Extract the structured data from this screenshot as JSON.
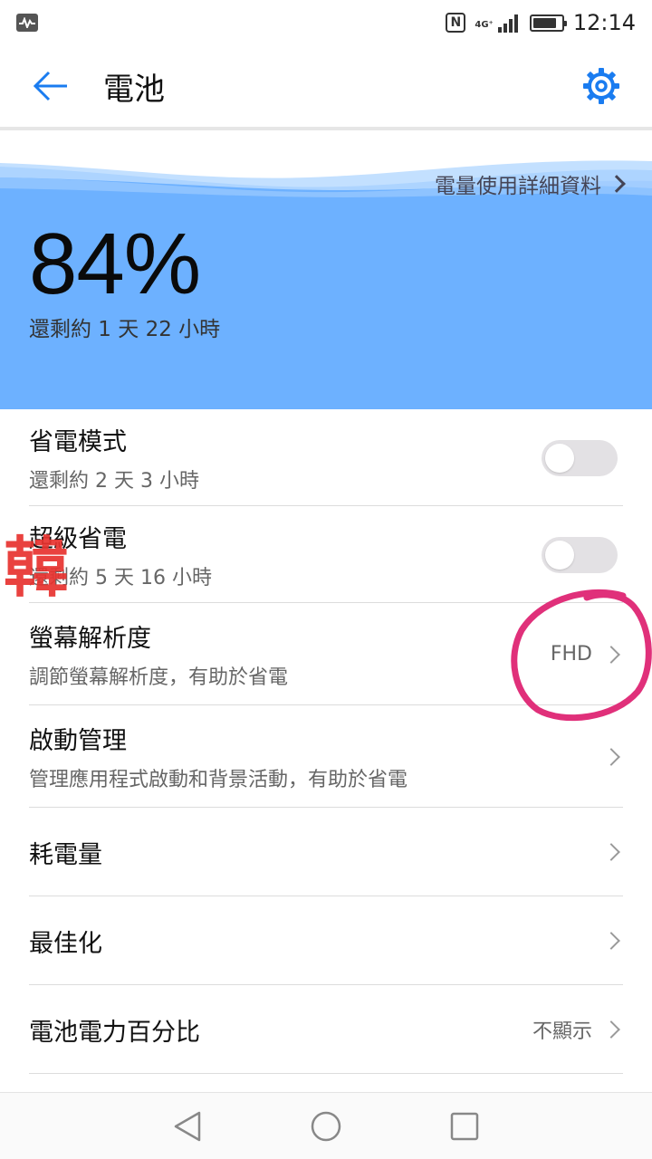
{
  "status_bar": {
    "network": "4G⁺",
    "time": "12:14",
    "battery_level": 0.84,
    "icons": [
      "pulse-icon",
      "nfc-icon",
      "signal-icon",
      "battery-icon"
    ]
  },
  "app_bar": {
    "title": "電池",
    "back_icon": "arrow-left-icon",
    "settings_icon": "gear-icon"
  },
  "hero": {
    "usage_link": "電量使用詳細資料",
    "percent": "84%",
    "remaining": "還剩約 1 天 22 小時",
    "colors": {
      "panel": "#6db1ff",
      "wave_light": "#b9daff"
    }
  },
  "list": {
    "power_saving": {
      "title": "省電模式",
      "subtitle": "還剩約 2 天 3 小時",
      "enabled": false
    },
    "ultra_saving": {
      "title": "超級省電",
      "subtitle": "還剩約 5 天 16 小時",
      "enabled": false
    },
    "resolution": {
      "title": "螢幕解析度",
      "subtitle": "調節螢幕解析度，有助於省電",
      "value": "FHD"
    },
    "startup": {
      "title": "啟動管理",
      "subtitle": "管理應用程式啟動和背景活動，有助於省電"
    },
    "consumption": {
      "title": "耗電量"
    },
    "optimize": {
      "title": "最佳化"
    },
    "battery_percent": {
      "title": "電池電力百分比",
      "value": "不顯示"
    }
  },
  "annotations": {
    "stamp_text": "韓",
    "stamp_color": "#e8332f",
    "circle_color": "#e0307a"
  },
  "nav_bar": {
    "icons": [
      "back-triangle-icon",
      "home-circle-icon",
      "recents-square-icon"
    ]
  }
}
